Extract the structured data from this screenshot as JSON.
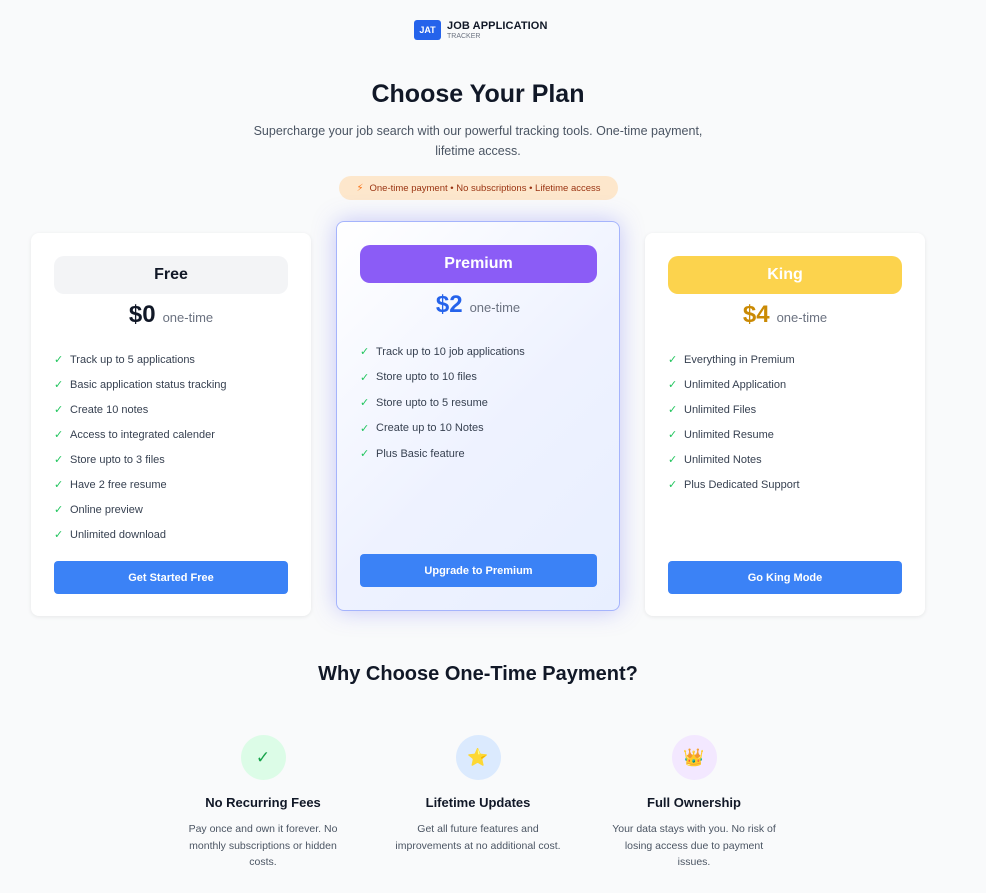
{
  "brand": {
    "badge": "JAT",
    "title": "JOB APPLICATION",
    "subtitle": "TRACKER"
  },
  "hero": {
    "title": "Choose Your Plan",
    "subtitle": "Supercharge your job search with our powerful tracking tools. One-time payment, lifetime access.",
    "pill": "One-time payment • No subscriptions • Lifetime access",
    "pill_icon": "⚡"
  },
  "plans": [
    {
      "name": "Free",
      "price": "$0",
      "period": "one-time",
      "features": [
        "Track up to 5 applications",
        "Basic application status tracking",
        "Create 10 notes",
        "Access to integrated calender",
        "Store upto to 3 files",
        "Have 2 free resume",
        "Online preview",
        "Unlimited download"
      ],
      "cta": "Get Started Free"
    },
    {
      "name": "Premium",
      "price": "$2",
      "period": "one-time",
      "features": [
        "Track up to 10 job applications",
        "Store upto to 10 files",
        "Store upto to 5 resume",
        "Create up to 10 Notes",
        "Plus Basic feature"
      ],
      "cta": "Upgrade to Premium"
    },
    {
      "name": "King",
      "price": "$4",
      "period": "one-time",
      "features": [
        "Everything in Premium",
        "Unlimited Application",
        "Unlimited Files",
        "Unlimited Resume",
        "Unlimited Notes",
        "Plus Dedicated Support"
      ],
      "cta": "Go King Mode"
    }
  ],
  "check_glyph": "✓",
  "why": {
    "title": "Why Choose One-Time Payment?",
    "benefits": [
      {
        "icon": "✓",
        "icon_name": "check-icon",
        "title": "No Recurring Fees",
        "desc": "Pay once and own it forever. No monthly subscriptions or hidden costs."
      },
      {
        "icon": "⭐",
        "icon_name": "star-icon",
        "title": "Lifetime Updates",
        "desc": "Get all future features and improvements at no additional cost."
      },
      {
        "icon": "👑",
        "icon_name": "crown-icon",
        "title": "Full Ownership",
        "desc": "Your data stays with you. No risk of losing access due to payment issues."
      }
    ]
  }
}
